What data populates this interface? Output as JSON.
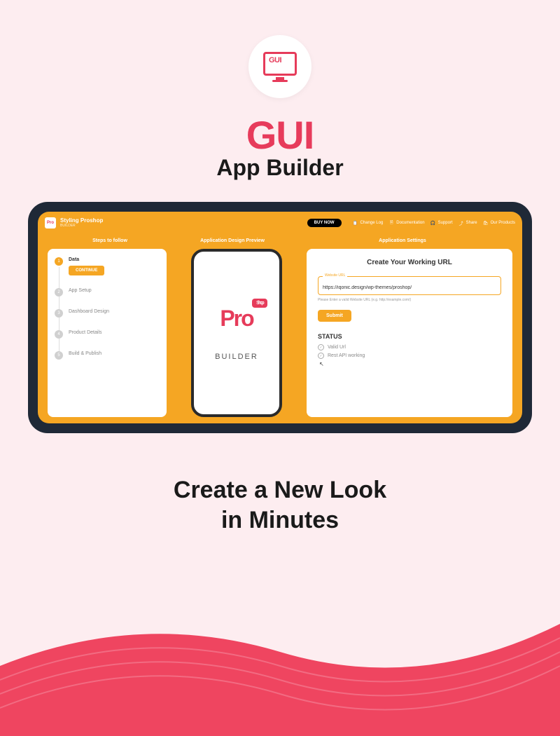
{
  "header": {
    "logo_text": "GUI",
    "title": "GUI",
    "subtitle": "App Builder"
  },
  "topbar": {
    "logo": "Pro",
    "title": "Styling Proshop",
    "subtitle": "BUILDER",
    "buy_label": "BUY NOW",
    "links": {
      "changelog": "Change Log",
      "documentation": "Documentation",
      "support": "Support",
      "share": "Share",
      "products": "Our Products"
    }
  },
  "section_labels": {
    "steps": "Steps to follow",
    "preview": "Application Design Preview",
    "settings": "Application Settings"
  },
  "steps": {
    "continue_label": "CONTINUE",
    "items": [
      {
        "num": "1",
        "label": "Data",
        "active": true
      },
      {
        "num": "2",
        "label": "App Setup",
        "active": false
      },
      {
        "num": "3",
        "label": "Dashboard Design",
        "active": false
      },
      {
        "num": "4",
        "label": "Product Details",
        "active": false
      },
      {
        "num": "5",
        "label": "Build & Publish",
        "active": false
      }
    ]
  },
  "preview": {
    "brand": "Pro",
    "badge": "Shop",
    "label": "BUILDER"
  },
  "settings": {
    "title": "Create Your Working URL",
    "url_legend": "Website URL",
    "url_value": "https://iqonic.design/wp-themes/proshop/",
    "url_hint": "Please Enter a valid Website URL (e.g. http://example.com/)",
    "submit_label": "Submit",
    "status_title": "STATUS",
    "status_items": [
      "Valid Url",
      "Rest API working"
    ]
  },
  "tagline": {
    "line1": "Create a New Look",
    "line2": "in Minutes"
  },
  "colors": {
    "accent": "#e63b5a",
    "orange": "#f5a623",
    "bg": "#fdedf0"
  }
}
